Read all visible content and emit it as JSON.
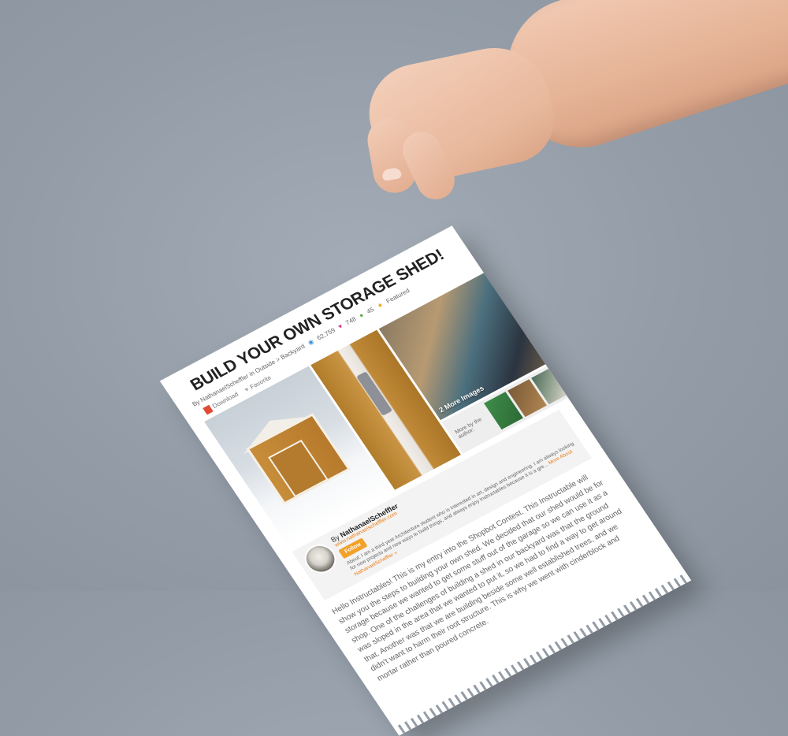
{
  "article": {
    "title": "BUILD YOUR OWN STORAGE SHED!",
    "byline": "By NathanaelScheffler in Outside > Backyard",
    "views": "62,759",
    "favorites": "748",
    "comments": "45",
    "featured": "Featured",
    "download_label": "Download",
    "favorite_label": "Favorite",
    "more_images_label": "2 More Images"
  },
  "author": {
    "byline_prefix": "By",
    "name": "NathanaelScheffler",
    "website": "www.nathanaelscheffler.com",
    "follow_label": "Follow",
    "more_by_label": "More by the author:",
    "about": "About: I am a third year Architecture student who is interested in art, design and engineering. I am always looking for new projects and new ways to build things, and always enjoy Instructables because it is a gre...",
    "about_link": "More About NathanaelScheffler »"
  },
  "body": {
    "paragraph": "Hello Instructables! This is my entry into the Shopbot Contest. This Instructable will show you the steps to building your own shed. We decided that our shed would be for storage because we wanted to get some stuff out of the garage so we can use it as a shop. One of the challenges of building a shed in our backyard was that the ground was sloped in the area that we wanted to put it, so we had to find a way to get around that. Another was that we are building beside some well established trees, and we didn't want to harm their root structure. This is why we went with cinderblock and mortar rather than poured concrete."
  },
  "colors": {
    "background": "#939ca7",
    "paper": "#ffffff",
    "accent_orange": "#f2a12b",
    "link_orange": "#e87d19"
  }
}
